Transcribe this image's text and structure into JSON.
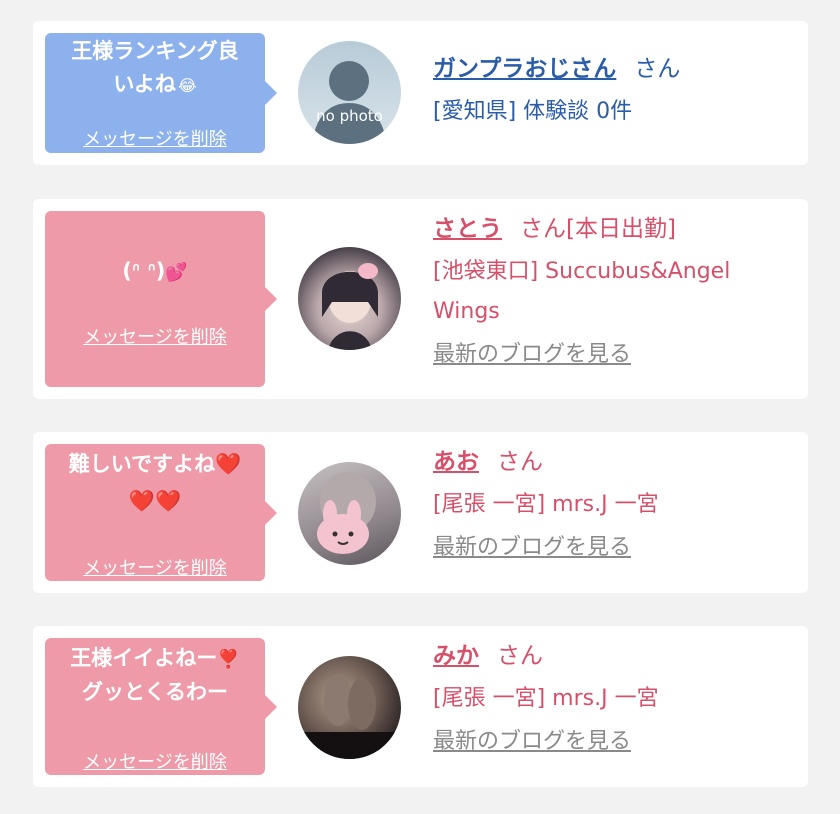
{
  "entries": [
    {
      "message_line1": "王様ランキング良",
      "message_line2": "いよね",
      "message_emoji": "😂",
      "delete_label": "メッセージを削除",
      "name": "ガンプラおじさん",
      "honorific": "さん",
      "location": "[愛知県] 体験談 0件",
      "avatar_text": "no photo",
      "colors": {
        "bubble": "#8cb1ec",
        "text": "#2a5caa"
      }
    },
    {
      "message_line1": "(ᐢ ᐢ)",
      "message_emoji": "💕",
      "delete_label": "メッセージを削除",
      "name": "さとう",
      "honorific": "さん[本日出勤]",
      "location_line1": "[池袋東口] Succubus&Angel",
      "location_line2": "Wings",
      "blog_label": "最新のブログを見る",
      "colors": {
        "bubble": "#ee9aa8",
        "text": "#d6506a"
      }
    },
    {
      "message_line1": "難しいですよね",
      "message_emoji_1": "❤️",
      "message_emoji_2": "❤️❤️",
      "delete_label": "メッセージを削除",
      "name": "あお",
      "honorific": "さん",
      "location": "[尾張 一宮] mrs.J 一宮",
      "blog_label": "最新のブログを見る",
      "colors": {
        "bubble": "#ee9aa8",
        "text": "#d6506a"
      }
    },
    {
      "message_line1": "王様イイよねー",
      "message_emoji": "❣️",
      "message_line2": "グッとくるわー",
      "delete_label": "メッセージを削除",
      "name": "みか",
      "honorific": "さん",
      "location": "[尾張 一宮] mrs.J 一宮",
      "blog_label": "最新のブログを見る",
      "colors": {
        "bubble": "#ee9aa8",
        "text": "#d6506a"
      }
    }
  ]
}
